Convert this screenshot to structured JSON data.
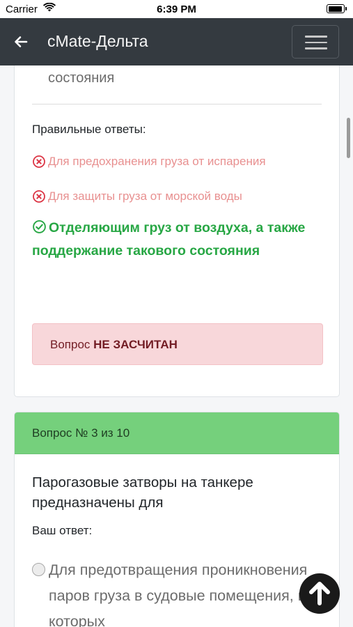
{
  "status_bar": {
    "carrier": "Carrier",
    "time": "6:39 PM"
  },
  "navbar": {
    "title": "cMate-Дельта"
  },
  "previous_card": {
    "tail_text": "состояния",
    "correct_label": "Правильные ответы:",
    "answers": [
      {
        "text": "Для предохранения груза от испарения",
        "status": "wrong"
      },
      {
        "text": "Для защиты груза от морской воды",
        "status": "wrong"
      },
      {
        "text": "Отделяющим груз от воздуха, а также поддержание такового состояния",
        "status": "correct"
      }
    ],
    "alert": {
      "prefix": "Вопрос ",
      "strong": "НЕ ЗАСЧИТАН"
    }
  },
  "current_card": {
    "header": "Вопрос № 3 из 10",
    "question": "Парогазовые затворы на танкере предназначены для",
    "your_answer_label": "Ваш ответ:",
    "options": [
      {
        "text": "Для предотвращения проникновения паров груза в судовые помещения, в которых"
      }
    ]
  },
  "colors": {
    "navbar": "#343a40",
    "correct": "#28a745",
    "wrong": "#e89090",
    "header": "#75d07c",
    "alert_bg": "#f8d7da"
  },
  "icons": {
    "back": "arrow-left-icon",
    "menu": "hamburger-icon",
    "wrong": "x-circle-icon",
    "correct": "check-circle-icon",
    "scroll_top": "arrow-up-circle-icon"
  }
}
